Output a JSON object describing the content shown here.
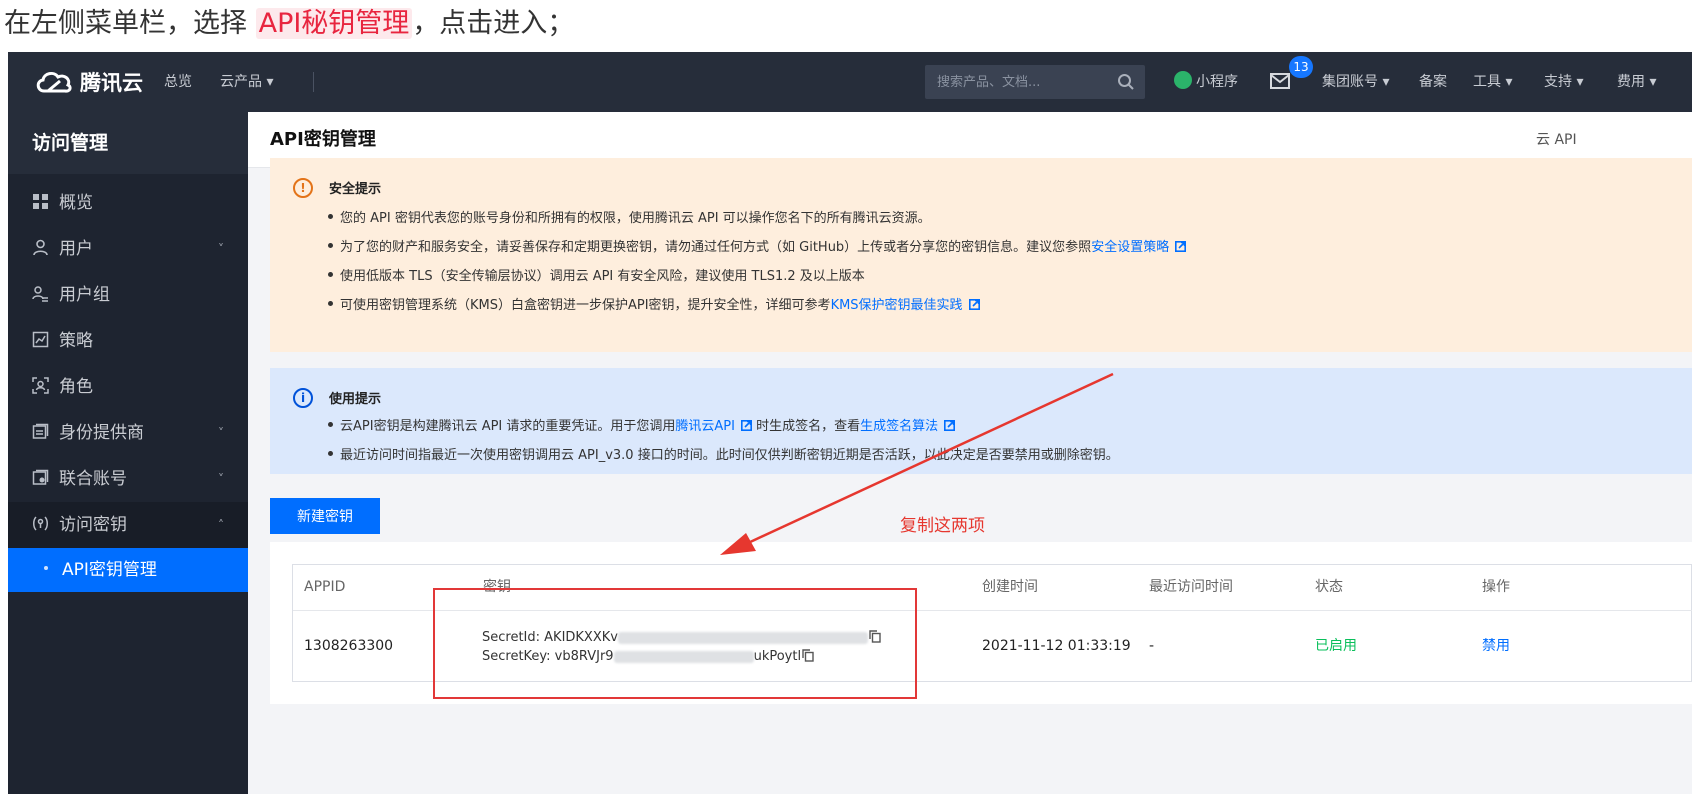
{
  "caption": {
    "before": "在左侧菜单栏，选择 ",
    "highlight": "API秘钥管理",
    "after": "，点击进入；"
  },
  "topnav": {
    "brand": "腾讯云",
    "overview": "总览",
    "products": "云产品 ▾",
    "search_placeholder": "搜索产品、文档...",
    "miniprogram": "小程序",
    "mail_count": "13",
    "group_account": "集团账号 ▾",
    "filing": "备案",
    "tools": "工具 ▾",
    "support": "支持 ▾",
    "billing": "费用 ▾"
  },
  "sidebar": {
    "title": "访问管理",
    "items": [
      {
        "label": "概览",
        "icon": "grid-icon"
      },
      {
        "label": "用户",
        "icon": "user-icon",
        "chevron": "˅"
      },
      {
        "label": "用户组",
        "icon": "user-group-icon"
      },
      {
        "label": "策略",
        "icon": "policy-icon"
      },
      {
        "label": "角色",
        "icon": "role-icon"
      },
      {
        "label": "身份提供商",
        "icon": "identity-provider-icon",
        "chevron": "˅"
      },
      {
        "label": "联合账号",
        "icon": "federated-account-icon",
        "chevron": "˅"
      },
      {
        "label": "访问密钥",
        "icon": "access-key-icon",
        "chevron": "˄"
      }
    ],
    "active_sub": "API密钥管理"
  },
  "page": {
    "title": "API密钥管理",
    "right_link": "云 API"
  },
  "security_notice": {
    "title": "安全提示",
    "line1": "您的 API 密钥代表您的账号身份和所拥有的权限，使用腾讯云 API 可以操作您名下的所有腾讯云资源。",
    "line2": "为了您的财产和服务安全，请妥善保存和定期更换密钥，请勿通过任何方式（如 GitHub）上传或者分享您的密钥信息。建议您参照",
    "line2_link": "安全设置策略",
    "line3": "使用低版本 TLS（安全传输层协议）调用云 API 有安全风险，建议使用 TLS1.2 及以上版本",
    "line4": "可使用密钥管理系统（KMS）白盒密钥进一步保护API密钥，提升安全性，详细可参考",
    "line4_link": "KMS保护密钥最佳实践"
  },
  "usage_notice": {
    "title": "使用提示",
    "line1_a": "云API密钥是构建腾讯云 API 请求的重要凭证。用于您调用",
    "line1_link1": "腾讯云API",
    "line1_b": "时生成签名，查看",
    "line1_link2": "生成签名算法",
    "line2": "最近访问时间指最近一次使用密钥调用云 API_v3.0 接口的时间。此时间仅供判断密钥近期是否活跃，以此决定是否要禁用或删除密钥。"
  },
  "new_key_button": "新建密钥",
  "annotation": "复制这两项",
  "table": {
    "headers": [
      "APPID",
      "密钥",
      "创建时间",
      "最近访问时间",
      "状态",
      "操作"
    ],
    "row": {
      "appid": "1308263300",
      "secret_id_label": "SecretId: AKIDKXXKv",
      "secret_key_label": "SecretKey: vb8RVJr9",
      "secret_key_tail": "ukPoytl",
      "created": "2021-11-12 01:33:19",
      "last_access": "-",
      "status": "已启用",
      "action": "禁用"
    }
  },
  "colors": {
    "accent": "#006eff",
    "nav_bg": "#262d3a",
    "sidebar_bg": "#1e2430",
    "warn_bg": "#feeedd",
    "info_bg": "#dbe8fc",
    "status_green": "#0abf5b",
    "annotation_red": "#e6372f"
  }
}
